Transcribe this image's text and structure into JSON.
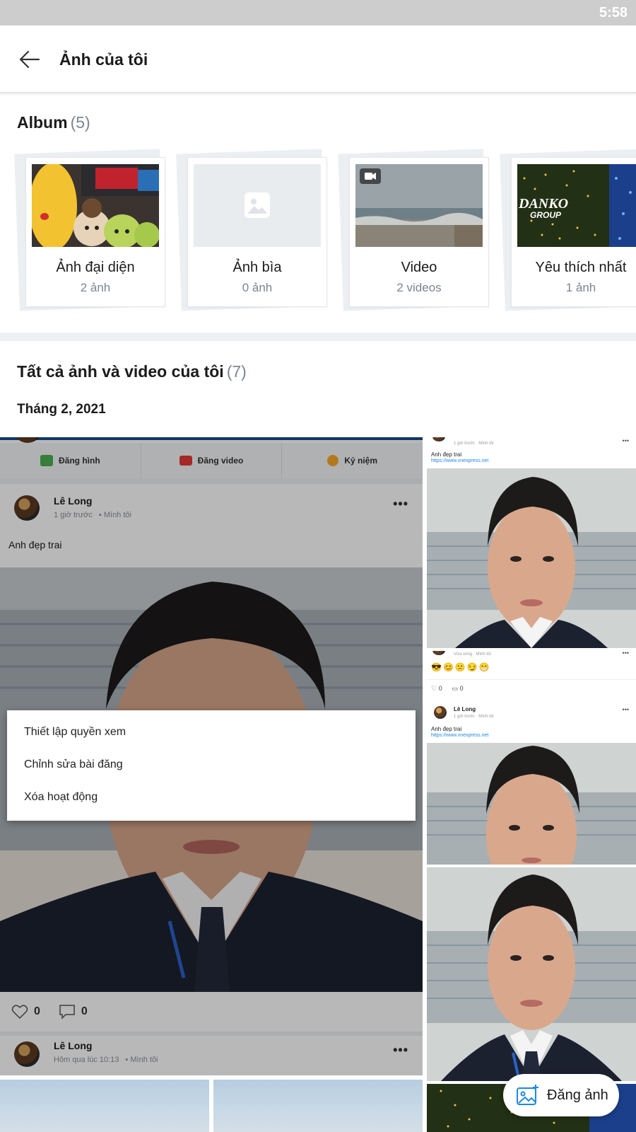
{
  "status_bar": {
    "time": "5:58"
  },
  "header": {
    "title": "Ảnh của tôi"
  },
  "albums_section": {
    "heading": "Album",
    "count": "(5)",
    "albums": [
      {
        "name": "Ảnh đại diện",
        "sub": "2 ảnh",
        "thumb": "stuffed-toys"
      },
      {
        "name": "Ảnh bìa",
        "sub": "0 ảnh",
        "thumb": "placeholder-image-icon"
      },
      {
        "name": "Video",
        "sub": "2 videos",
        "thumb": "beach-video"
      },
      {
        "name": "Yêu thích nhất",
        "sub": "1 ảnh",
        "thumb": "danko-lights"
      }
    ],
    "danko_sign": {
      "line1": "DANKO",
      "line2": "GROUP"
    }
  },
  "all_section": {
    "heading": "Tất cả ảnh và video của tôi",
    "count": "(7)",
    "month": "Tháng 2, 2021"
  },
  "big_tile": {
    "actions": [
      {
        "label": "Đăng hình",
        "icon": "image-icon",
        "color": "#4caf50"
      },
      {
        "label": "Đăng video",
        "icon": "video-icon",
        "color": "#e53935"
      },
      {
        "label": "Kỷ niệm",
        "icon": "memory-icon",
        "color": "#f9a825"
      }
    ],
    "post": {
      "author": "Lê Long",
      "time": "1 giờ trước",
      "privacy": "Mình tôi",
      "caption": "Anh đẹp trai",
      "likes": "0",
      "comments": "0"
    },
    "post2": {
      "author": "Lê Long",
      "time": "Hôm qua lúc 10:13",
      "privacy": "Mình tôi"
    },
    "context_menu": [
      "Thiết lập quyền xem",
      "Chỉnh sửa bài đăng",
      "Xóa hoạt động"
    ]
  },
  "right_tiles": {
    "tile1": {
      "time": "1 giờ trước",
      "privacy": "Mình tôi",
      "caption": "Anh đẹp trai",
      "link": "https://www.vnexpress.net"
    },
    "tile2": {
      "time": "Vừa xong",
      "privacy": "Mình tôi",
      "emojis": "😎😊😕😏😁",
      "likes": "0",
      "comments": "0"
    },
    "tile3": {
      "author": "Lê Long",
      "time": "1 giờ trước",
      "privacy": "Mình tôi",
      "caption": "Anh đẹp trai",
      "link": "https://www.vnexpress.net"
    }
  },
  "fab": {
    "label": "Đăng ảnh",
    "icon": "add-photo-icon"
  },
  "colors": {
    "accent": "#1e88e5",
    "text": "#1b1b1b",
    "muted": "#7c8591",
    "divider": "#eef0f3"
  }
}
